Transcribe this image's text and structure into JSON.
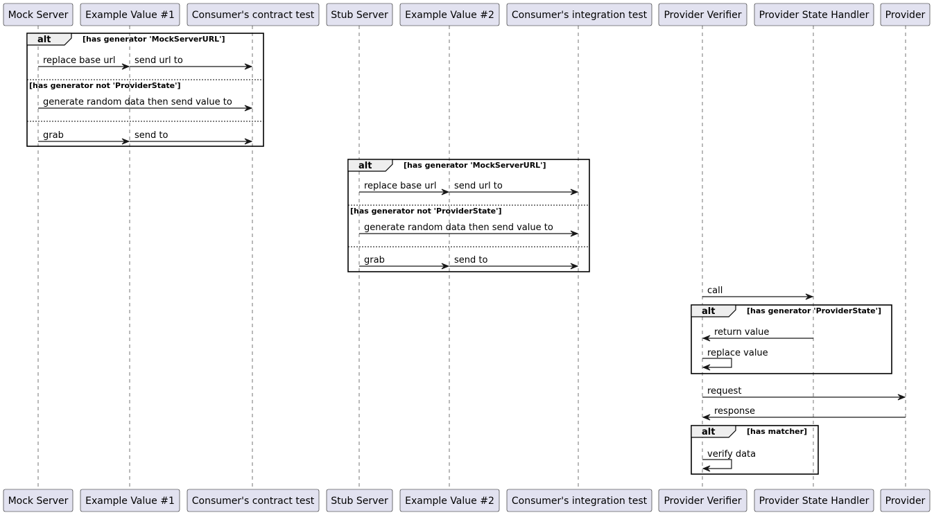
{
  "participants": [
    {
      "id": "mock_server",
      "label": "Mock Server"
    },
    {
      "id": "example_value_1",
      "label": "Example Value #1"
    },
    {
      "id": "consumer_contract_test",
      "label": "Consumer's contract test"
    },
    {
      "id": "stub_server",
      "label": "Stub Server"
    },
    {
      "id": "example_value_2",
      "label": "Example Value #2"
    },
    {
      "id": "consumer_integration_test",
      "label": "Consumer's integration test"
    },
    {
      "id": "provider_verifier",
      "label": "Provider Verifier"
    },
    {
      "id": "provider_state_handler",
      "label": "Provider State Handler"
    },
    {
      "id": "provider",
      "label": "Provider"
    }
  ],
  "frames": [
    {
      "keyword": "alt",
      "sections": [
        {
          "guard": "[has generator 'MockServerURL']",
          "messages": [
            {
              "from": "mock_server",
              "to": "example_value_1",
              "label": "replace base url"
            },
            {
              "from": "example_value_1",
              "to": "consumer_contract_test",
              "label": "send url to"
            }
          ]
        },
        {
          "guard": "[has generator not 'ProviderState']",
          "messages": [
            {
              "from": "mock_server",
              "to": "consumer_contract_test",
              "label": "generate random data then send value to"
            }
          ]
        },
        {
          "guard": "",
          "messages": [
            {
              "from": "mock_server",
              "to": "example_value_1",
              "label": "grab"
            },
            {
              "from": "example_value_1",
              "to": "consumer_contract_test",
              "label": "send to"
            }
          ]
        }
      ]
    },
    {
      "keyword": "alt",
      "sections": [
        {
          "guard": "[has generator 'MockServerURL']",
          "messages": [
            {
              "from": "stub_server",
              "to": "example_value_2",
              "label": "replace base url"
            },
            {
              "from": "example_value_2",
              "to": "consumer_integration_test",
              "label": "send url to"
            }
          ]
        },
        {
          "guard": "[has generator not 'ProviderState']",
          "messages": [
            {
              "from": "stub_server",
              "to": "consumer_integration_test",
              "label": "generate random data then send value to"
            }
          ]
        },
        {
          "guard": "",
          "messages": [
            {
              "from": "stub_server",
              "to": "example_value_2",
              "label": "grab"
            },
            {
              "from": "example_value_2",
              "to": "consumer_integration_test",
              "label": "send to"
            }
          ]
        }
      ]
    },
    {
      "keyword": "alt",
      "sections": [
        {
          "guard": "[has generator 'ProviderState']",
          "messages": [
            {
              "from": "provider_state_handler",
              "to": "provider_verifier",
              "label": "return value"
            },
            {
              "from": "provider_verifier",
              "to": "provider_verifier",
              "label": "replace value"
            }
          ]
        }
      ]
    },
    {
      "keyword": "alt",
      "sections": [
        {
          "guard": "[has matcher]",
          "messages": [
            {
              "from": "provider_verifier",
              "to": "provider_verifier",
              "label": "verify data"
            }
          ]
        }
      ]
    }
  ],
  "standalone_messages": [
    {
      "from": "provider_verifier",
      "to": "provider_state_handler",
      "label": "call"
    },
    {
      "from": "provider_verifier",
      "to": "provider",
      "label": "request"
    },
    {
      "from": "provider",
      "to": "provider_verifier",
      "label": "response"
    }
  ]
}
